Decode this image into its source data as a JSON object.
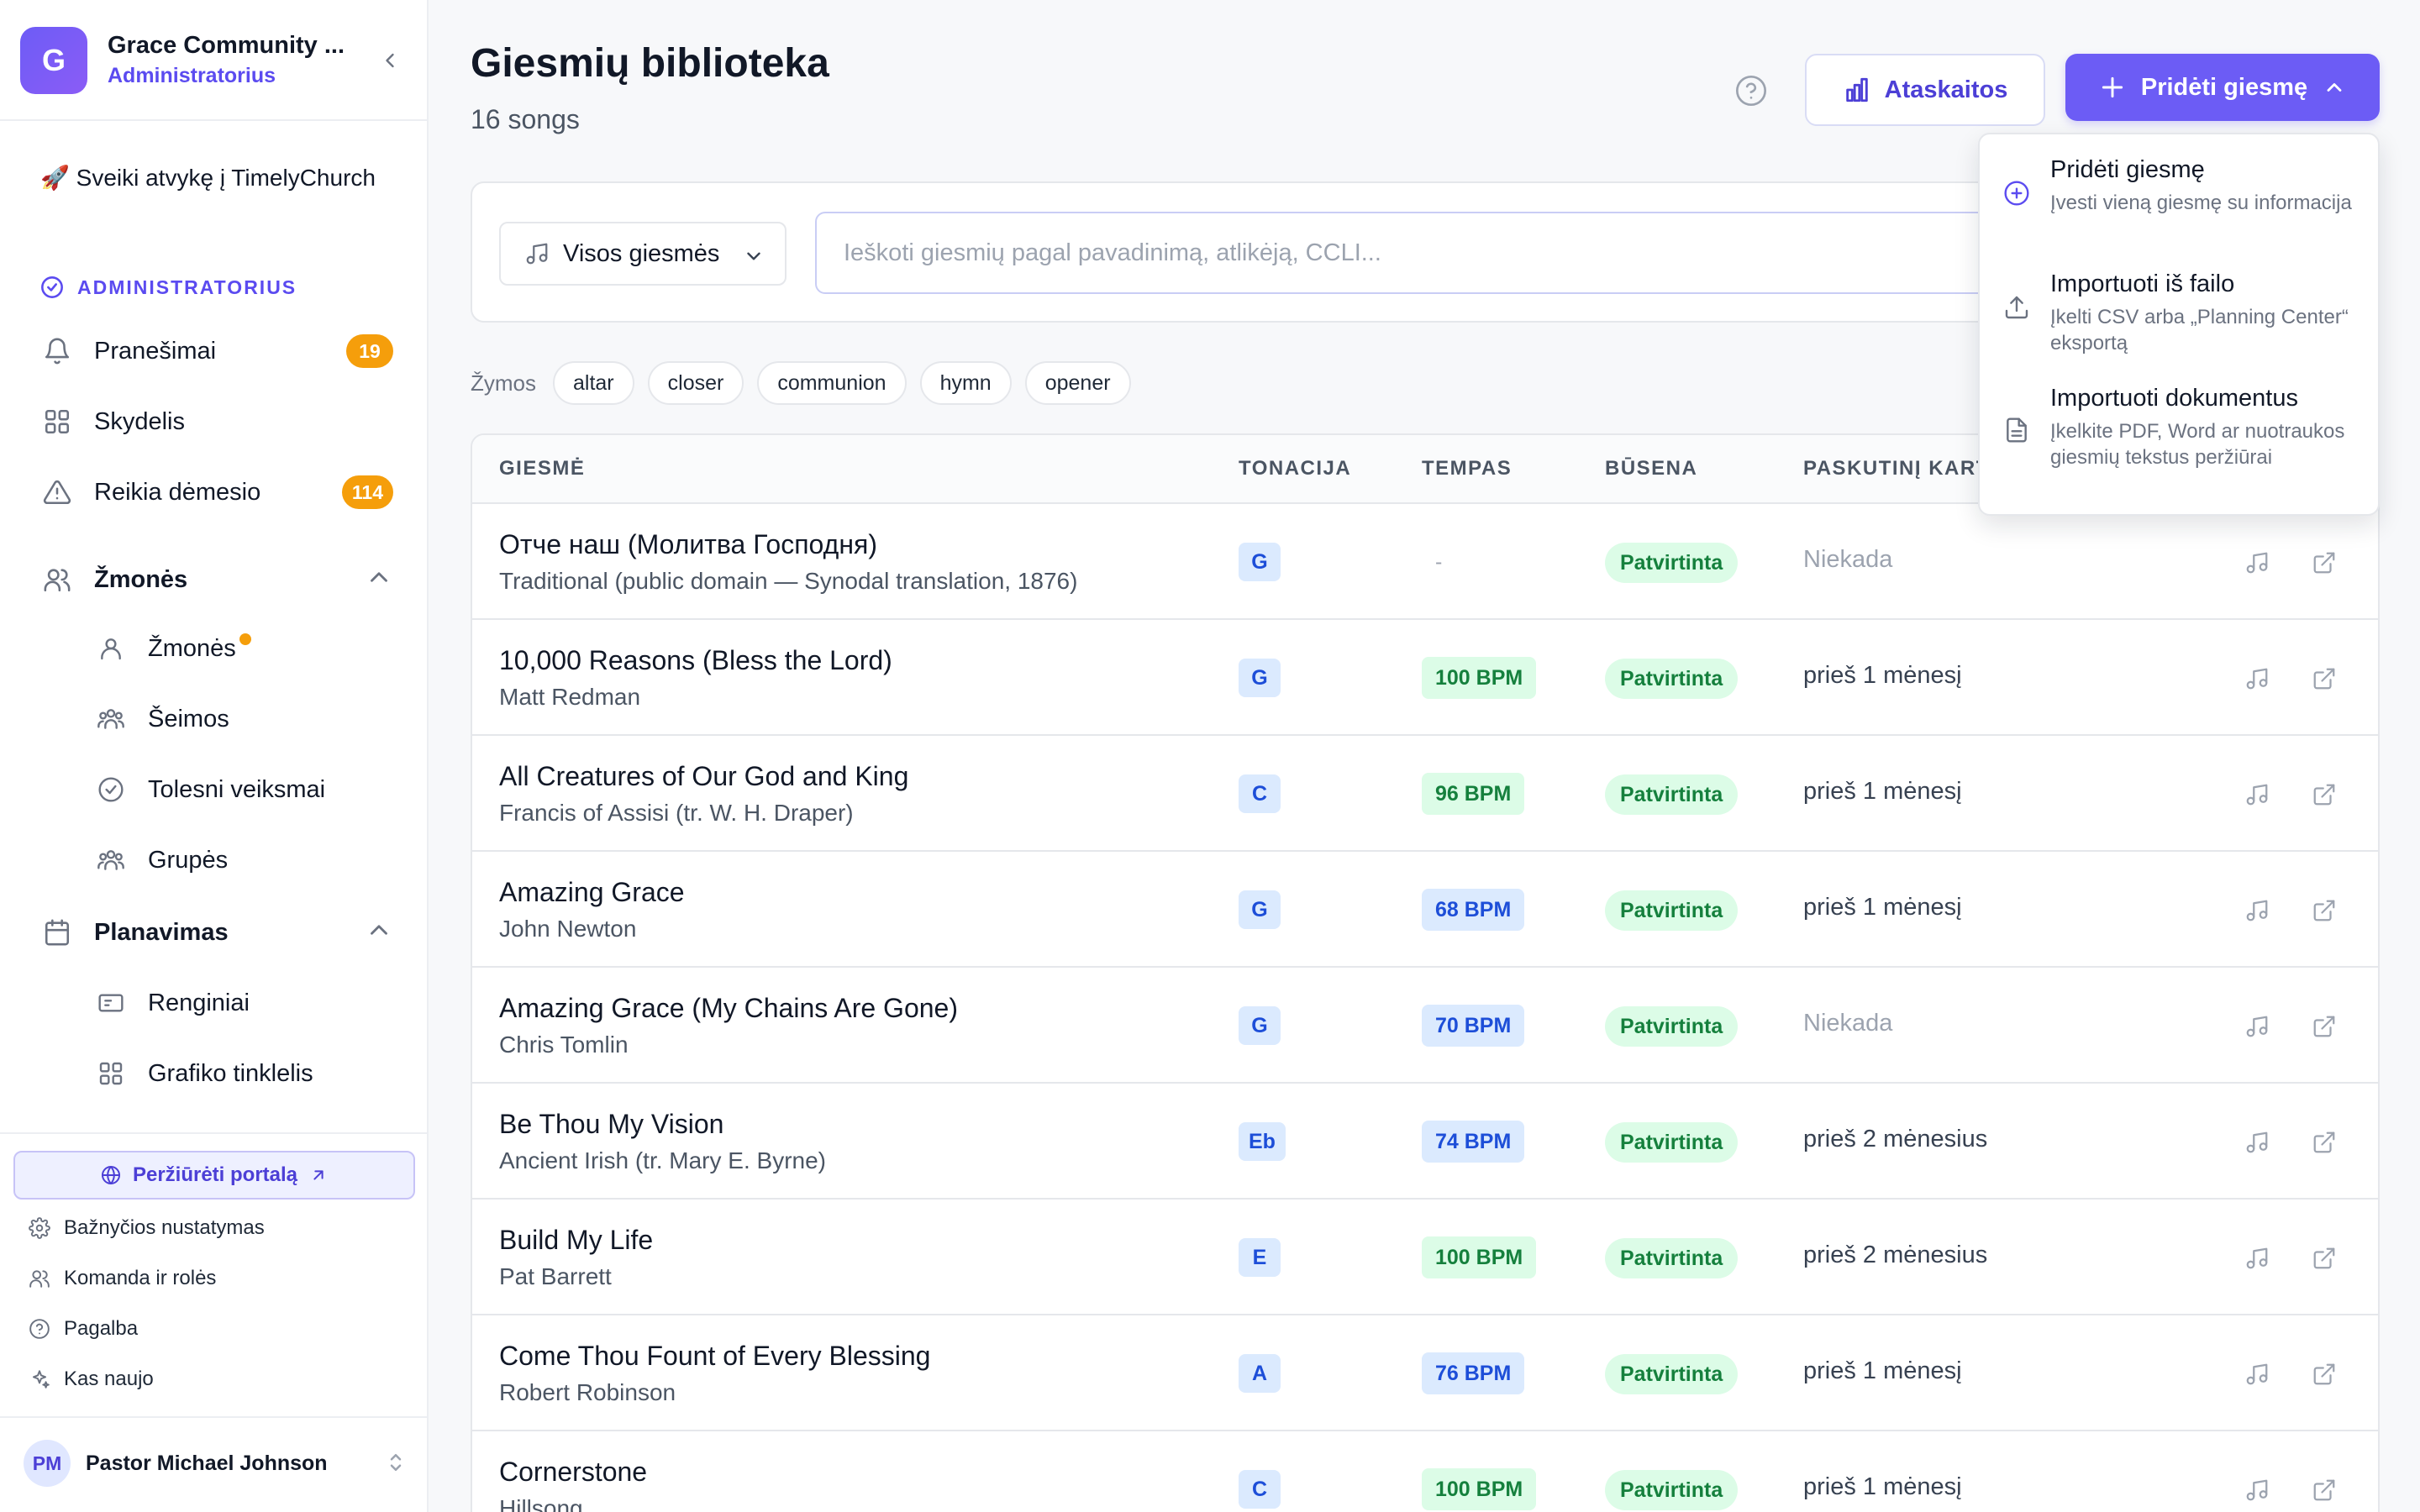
{
  "org": {
    "initial": "G",
    "name": "Grace Community ...",
    "role": "Administratorius"
  },
  "sidebar": {
    "welcome": "🚀 Sveiki atvykę į TimelyChurch",
    "section_label": "ADMINISTRATORIUS",
    "items": {
      "notifications": {
        "label": "Pranešimai",
        "badge": "19"
      },
      "dashboard": {
        "label": "Skydelis"
      },
      "attention": {
        "label": "Reikia dėmesio",
        "badge": "114"
      },
      "people_group": {
        "label": "Žmonės"
      },
      "people": {
        "label": "Žmonės"
      },
      "families": {
        "label": "Šeimos"
      },
      "followups": {
        "label": "Tolesni veiksmai"
      },
      "groups": {
        "label": "Grupės"
      },
      "planning_group": {
        "label": "Planavimas"
      },
      "events": {
        "label": "Renginiai"
      },
      "schedule": {
        "label": "Grafiko tinklelis"
      }
    },
    "portal_button": "Peržiūrėti portalą",
    "footer": {
      "settings": "Bažnyčios nustatymas",
      "team": "Komanda ir rolės",
      "help": "Pagalba",
      "whats_new": "Kas naujo"
    },
    "user": {
      "initials": "PM",
      "name": "Pastor Michael Johnson"
    }
  },
  "header": {
    "title": "Giesmių biblioteka",
    "subtitle": "16 songs",
    "reports_button": "Ataskaitos",
    "add_button": "Pridėti giesmę"
  },
  "filters": {
    "select_value": "Visos giesmės",
    "search_placeholder": "Ieškoti giesmių pagal pavadinimą, atlikėją, CCLI...",
    "tags_label": "Žymos",
    "tags": [
      "altar",
      "closer",
      "communion",
      "hymn",
      "opener"
    ]
  },
  "table": {
    "columns": {
      "song": "GIESMĖ",
      "key": "TONACIJA",
      "tempo": "TEMPAS",
      "status": "BŪSENA",
      "last": "PASKUTINĮ KART"
    },
    "rows": [
      {
        "title": "Отче наш (Молитва Господня)",
        "author": "Traditional (public domain — Synodal translation, 1876)",
        "key": "G",
        "tempo": "-",
        "tempo_color": "none",
        "status": "Patvirtinta",
        "last": "Niekada",
        "never": true
      },
      {
        "title": "10,000 Reasons (Bless the Lord)",
        "author": "Matt Redman",
        "key": "G",
        "tempo": "100 BPM",
        "tempo_color": "green",
        "status": "Patvirtinta",
        "last": "prieš 1 mėnesį",
        "never": false
      },
      {
        "title": "All Creatures of Our God and King",
        "author": "Francis of Assisi (tr. W. H. Draper)",
        "key": "C",
        "tempo": "96 BPM",
        "tempo_color": "green",
        "status": "Patvirtinta",
        "last": "prieš 1 mėnesį",
        "never": false
      },
      {
        "title": "Amazing Grace",
        "author": "John Newton",
        "key": "G",
        "tempo": "68 BPM",
        "tempo_color": "blue",
        "status": "Patvirtinta",
        "last": "prieš 1 mėnesį",
        "never": false
      },
      {
        "title": "Amazing Grace (My Chains Are Gone)",
        "author": "Chris Tomlin",
        "key": "G",
        "tempo": "70 BPM",
        "tempo_color": "blue",
        "status": "Patvirtinta",
        "last": "Niekada",
        "never": true
      },
      {
        "title": "Be Thou My Vision",
        "author": "Ancient Irish (tr. Mary E. Byrne)",
        "key": "Eb",
        "tempo": "74 BPM",
        "tempo_color": "blue",
        "status": "Patvirtinta",
        "last": "prieš 2 mėnesius",
        "never": false
      },
      {
        "title": "Build My Life",
        "author": "Pat Barrett",
        "key": "E",
        "tempo": "100 BPM",
        "tempo_color": "green",
        "status": "Patvirtinta",
        "last": "prieš 2 mėnesius",
        "never": false
      },
      {
        "title": "Come Thou Fount of Every Blessing",
        "author": "Robert Robinson",
        "key": "A",
        "tempo": "76 BPM",
        "tempo_color": "blue",
        "status": "Patvirtinta",
        "last": "prieš 1 mėnesį",
        "never": false
      },
      {
        "title": "Cornerstone",
        "author": "Hillsong",
        "key": "C",
        "tempo": "100 BPM",
        "tempo_color": "green",
        "status": "Patvirtinta",
        "last": "prieš 1 mėnesį",
        "never": false
      }
    ]
  },
  "dropdown": {
    "items": [
      {
        "title": "Pridėti giesmę",
        "desc": "Įvesti vieną giesmę su informacija",
        "icon": "plus-circle-icon"
      },
      {
        "title": "Importuoti iš failo",
        "desc": "Įkelti CSV arba „Planning Center“ eksportą",
        "icon": "upload-icon"
      },
      {
        "title": "Importuoti dokumentus",
        "desc": "Įkelkite PDF, Word ar nuotraukos giesmių tekstus peržiūrai",
        "icon": "document-icon"
      }
    ]
  },
  "colors": {
    "accent": "#6c5cf5",
    "badge": "#f59e0b",
    "success": "#15803d"
  }
}
